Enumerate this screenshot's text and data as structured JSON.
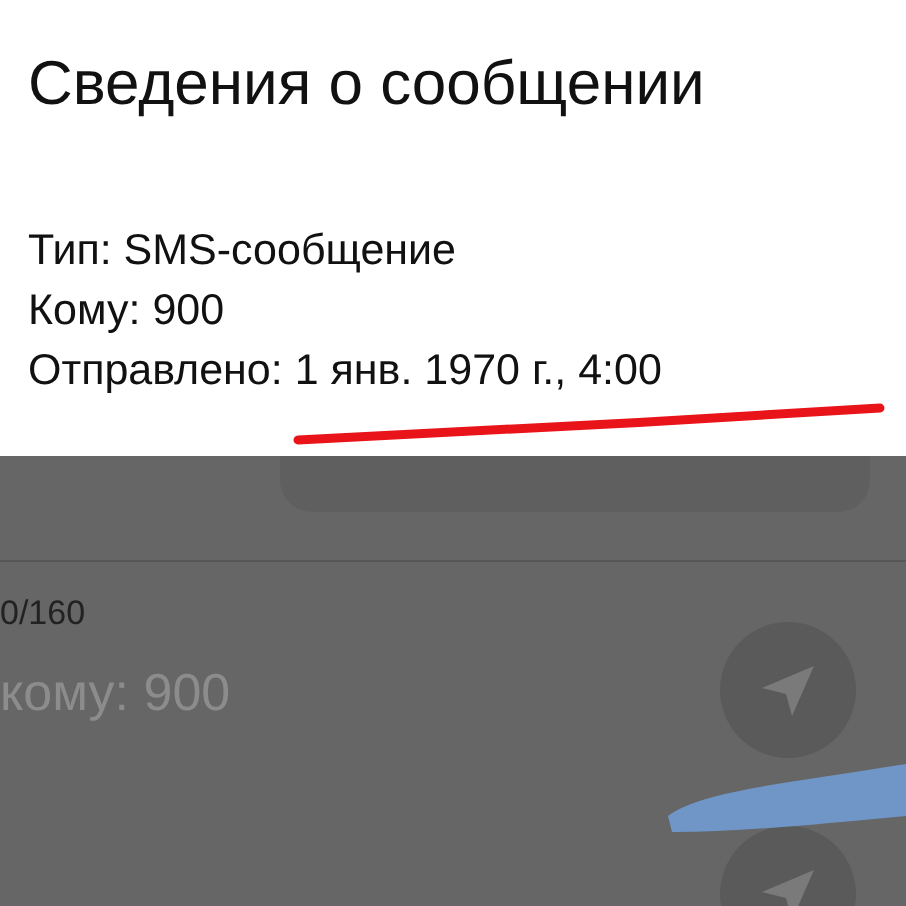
{
  "dialog": {
    "title": "Сведения о сообщении",
    "details": [
      {
        "text": "Тип: SMS-сообщение"
      },
      {
        "text": "Кому: 900"
      },
      {
        "text": "Отправлено: 1 янв. 1970 г., 4:00"
      }
    ]
  },
  "compose": {
    "char_counter": "0/160",
    "message_field": {
      "placeholder": "кому: 900"
    }
  }
}
